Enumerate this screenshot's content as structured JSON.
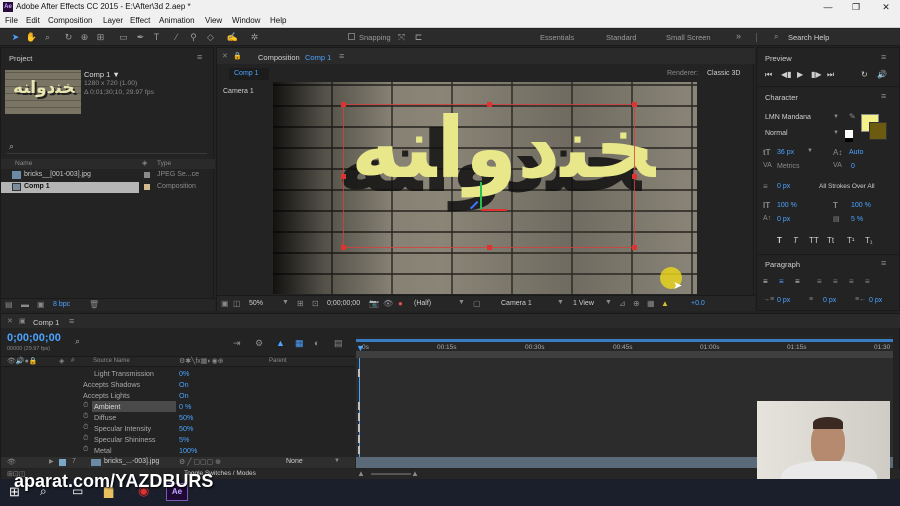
{
  "titlebar": {
    "title": "Adobe After Effects CC 2015 - E:\\After\\3d 2.aep *",
    "app_icon": "Ae",
    "minimize": "—",
    "maximize": "❐",
    "close": "✕"
  },
  "menubar": [
    "File",
    "Edit",
    "Composition",
    "Layer",
    "Effect",
    "Animation",
    "View",
    "Window",
    "Help"
  ],
  "toolbar": {
    "snapping": "Snapping",
    "workspaces": [
      "Essentials",
      "Standard",
      "Small Screen"
    ],
    "more": "»",
    "search_help": "Search Help"
  },
  "project": {
    "tab": "Project",
    "comp_name": "Comp 1 ▼",
    "comp_size": "1280 x 720 (1.00)",
    "comp_dur": "Δ 0;01;30;10, 29.97 fps",
    "thumb_text": "ﺨﻨﺩﻭﺍﻨﻪ",
    "col_name": "Name",
    "col_type": "Type",
    "items": [
      {
        "name": "bricks__[001-003].jpg",
        "type": "JPEG Se...ce"
      },
      {
        "name": "Comp 1",
        "type": "Composition"
      }
    ],
    "bpc": "8 bpc"
  },
  "composition": {
    "tab_prefix": "Composition",
    "tab_name": "Comp 1",
    "subtab": "Comp 1",
    "renderer_label": "Renderer:",
    "renderer": "Classic 3D",
    "camera_label": "Camera 1",
    "text_main": "ﺨﻨﺩﻭﺍﻨﻪ",
    "zoom": "50%",
    "timecode": "0;00;00;00",
    "resolution": "(Half)",
    "view_camera": "Camera 1",
    "views": "1 View",
    "exposure": "+0.0"
  },
  "preview": {
    "tab": "Preview"
  },
  "character": {
    "tab": "Character",
    "font": "LMN Mandana",
    "style": "Normal",
    "size": "36 px",
    "leading": "Auto",
    "kerning": "Metrics",
    "tracking": "0",
    "stroke_w": "0 px",
    "stroke_mode": "All Strokes Over All",
    "vscale": "100 %",
    "hscale": "100 %",
    "baseline": "0 px",
    "tsume": "5 %",
    "fill_color": "#f4f08a",
    "stroke_color": "#6b5a10"
  },
  "paragraph": {
    "tab": "Paragraph",
    "indent_left": "0 px",
    "indent_mid": "0 px",
    "indent_right": "0 px"
  },
  "timeline": {
    "tab": "Comp 1",
    "timecode": "0;00;00;00",
    "frames": "00000 (29.97 fps)",
    "col_source": "Source Name",
    "col_parent": "Parent",
    "ticks": [
      "0s",
      "00:15s",
      "00:30s",
      "00:45s",
      "01:00s",
      "01:15s",
      "01:30"
    ],
    "props": [
      {
        "label": "Light Transmission",
        "value": "0%"
      },
      {
        "label": "Accepts Shadows",
        "value": "On"
      },
      {
        "label": "Accepts Lights",
        "value": "On"
      },
      {
        "label": "Ambient",
        "value": "0 %"
      },
      {
        "label": "Diffuse",
        "value": "50%"
      },
      {
        "label": "Specular Intensity",
        "value": "50%"
      },
      {
        "label": "Specular Shininess",
        "value": "5%"
      },
      {
        "label": "Metal",
        "value": "100%"
      }
    ],
    "layer_num": "7",
    "layer_name": "bricks_...-003].jpg",
    "parent": "None",
    "toggle": "Toggle Switches / Modes"
  },
  "watermark": "aparat.com/YAZDBURS",
  "colors": {
    "accent": "#4aa3ff",
    "panel": "#232323",
    "highlight": "#e8e88a"
  }
}
